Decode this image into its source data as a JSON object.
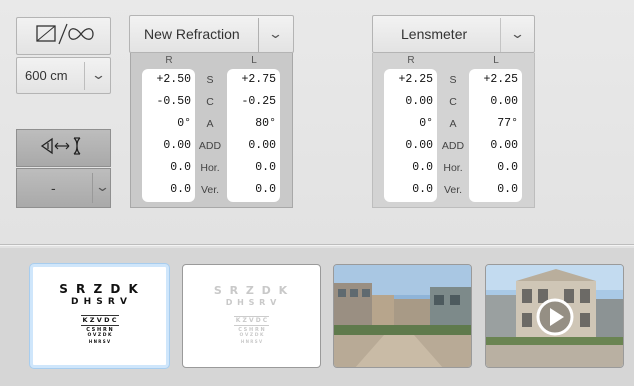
{
  "left_panel": {
    "mode_icon": "square-infinity-icon",
    "distance": "600 cm",
    "eye_switch_icon": "eye-lens-switch-icon",
    "eye_select_value": "-"
  },
  "refraction": {
    "title": "New Refraction",
    "col_right": "R",
    "col_left": "L",
    "labels": [
      "S",
      "C",
      "A",
      "ADD",
      "Hor.",
      "Ver."
    ],
    "right": [
      "+2.50",
      "-0.50",
      "0°",
      "0.00",
      "0.0",
      "0.0"
    ],
    "left": [
      "+2.75",
      "-0.25",
      "80°",
      "0.00",
      "0.0",
      "0.0"
    ]
  },
  "lensmeter": {
    "title": "Lensmeter",
    "col_right": "R",
    "col_left": "L",
    "labels": [
      "S",
      "C",
      "A",
      "ADD",
      "Hor.",
      "Ver."
    ],
    "right": [
      "+2.25",
      "0.00",
      "0°",
      "0.00",
      "0.0",
      "0.0"
    ],
    "left": [
      "+2.25",
      "0.00",
      "77°",
      "0.00",
      "0.0",
      "0.0"
    ]
  },
  "thumbnails": {
    "chart_lines": [
      "S R Z D K",
      "D H S R V",
      "K Z V D C",
      "C S H R N",
      "O V Z D K",
      "H N R S V"
    ],
    "scene_1": "street-scene-image",
    "scene_2": "building-video-image",
    "play_icon": "play-icon"
  },
  "colors": {
    "panel_bg": "#c9c9c9",
    "selected_border": "#cfe6fb"
  }
}
